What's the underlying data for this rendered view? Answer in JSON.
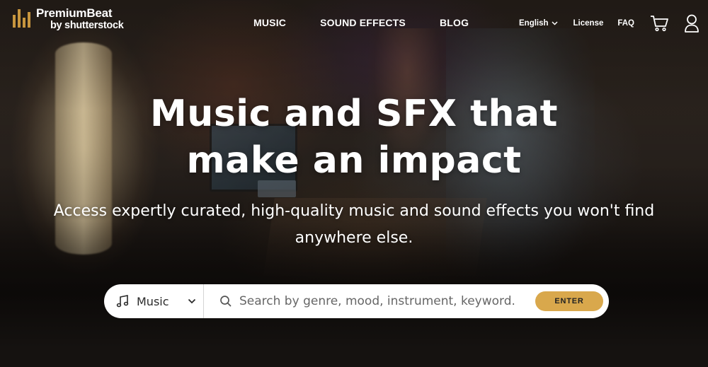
{
  "brand": {
    "name": "PremiumBeat",
    "byline": "by shutterstock",
    "accent_color": "#c8963e"
  },
  "nav": {
    "items": [
      {
        "label": "MUSIC"
      },
      {
        "label": "SOUND EFFECTS"
      },
      {
        "label": "BLOG"
      }
    ]
  },
  "utility_nav": {
    "language": "English",
    "license": "License",
    "faq": "FAQ",
    "cart_icon": "shopping-cart-icon",
    "account_icon": "user-icon"
  },
  "hero": {
    "headline": "Music and SFX that make an impact",
    "subheadline": "Access expertly curated, high-quality music and sound effects you won't find anywhere else."
  },
  "search": {
    "category_icon": "music-note-icon",
    "category_selected": "Music",
    "placeholder": "Search by genre, mood, instrument, keyword...",
    "value": "",
    "button_label": "ENTER",
    "button_color": "#d9a84c"
  }
}
